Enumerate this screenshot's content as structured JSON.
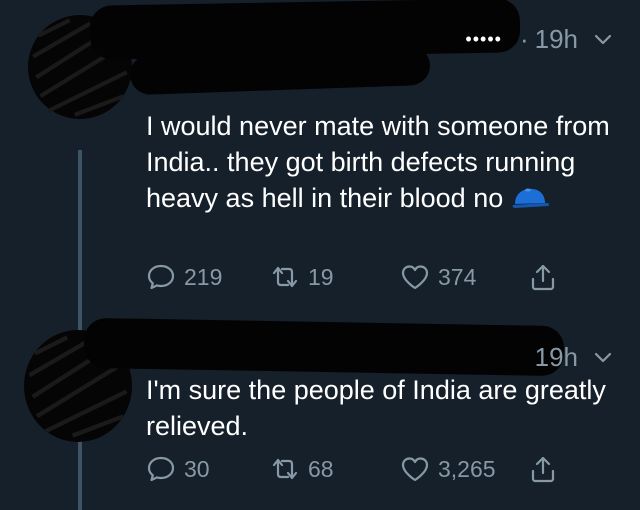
{
  "tweets": [
    {
      "time": "19h",
      "text": "I would never mate with someone from India.. they got birth defects running heavy as hell in their blood no",
      "emoji_icon": "blue-cap-icon",
      "reply_count": "219",
      "retweet_count": "19",
      "like_count": "374"
    },
    {
      "time": "19h",
      "text": "I'm sure the people of India are greatly relieved.",
      "reply_count": "30",
      "retweet_count": "68",
      "like_count": "3,265"
    }
  ],
  "header": {
    "more_dots": "•••••",
    "separator": "·"
  },
  "colors": {
    "background": "#15202b",
    "muted_text": "#8899a6",
    "thread_line": "#3d5466",
    "cap_blue": "#1d6fd8"
  }
}
